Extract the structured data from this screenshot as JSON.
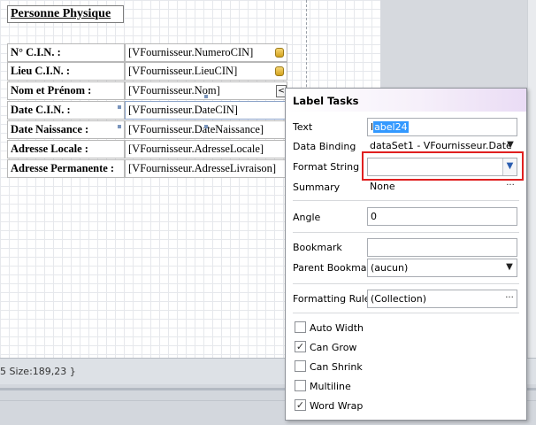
{
  "report": {
    "title": "Personne Physique",
    "rows": [
      {
        "label": "N° C.I.N. :",
        "field": "[VFournisseur.NumeroCIN]"
      },
      {
        "label": "Lieu C.I.N. :",
        "field": "[VFournisseur.LieuCIN]"
      },
      {
        "label": "Nom et Prénom :",
        "field": "[VFournisseur.Nom]"
      },
      {
        "label": "Date C.I.N. :",
        "field": "[VFournisseur.DateCIN]"
      },
      {
        "label": "Date Naissance :",
        "field": "[VFournisseur.DateNaissance]"
      },
      {
        "label": "Adresse Locale :",
        "field": "[VFournisseur.AdresseLocale]"
      },
      {
        "label": "Adresse Permanente :",
        "field": "[VFournisseur.AdresseLivraison]"
      }
    ],
    "tasks_arrow": "<"
  },
  "status": {
    "text": "5 Size:189,23 }"
  },
  "tasks": {
    "title": "Label Tasks",
    "text_label": "Text",
    "text_value_prefix": "l",
    "text_value_selected": "abel24",
    "data_binding_label": "Data Binding",
    "data_binding_value": "dataSet1 - VFournisseur.Date",
    "format_string_label": "Format String",
    "format_string_value": "",
    "summary_label": "Summary",
    "summary_value": "None",
    "angle_label": "Angle",
    "angle_value": "0",
    "bookmark_label": "Bookmark",
    "bookmark_value": "",
    "parent_bookmark_label": "Parent Bookmark",
    "parent_bookmark_value": "(aucun)",
    "formatting_rules_label": "Formatting Rules",
    "formatting_rules_value": "(Collection)",
    "ellipsis": "···",
    "dropdown_glyph": "▼",
    "checkboxes": [
      {
        "label": "Auto Width",
        "checked": false
      },
      {
        "label": "Can Grow",
        "checked": true
      },
      {
        "label": "Can Shrink",
        "checked": false
      },
      {
        "label": "Multiline",
        "checked": false
      },
      {
        "label": "Word Wrap",
        "checked": true
      }
    ]
  },
  "colors": {
    "highlight": "#e02020",
    "selection": "#3399ff"
  }
}
